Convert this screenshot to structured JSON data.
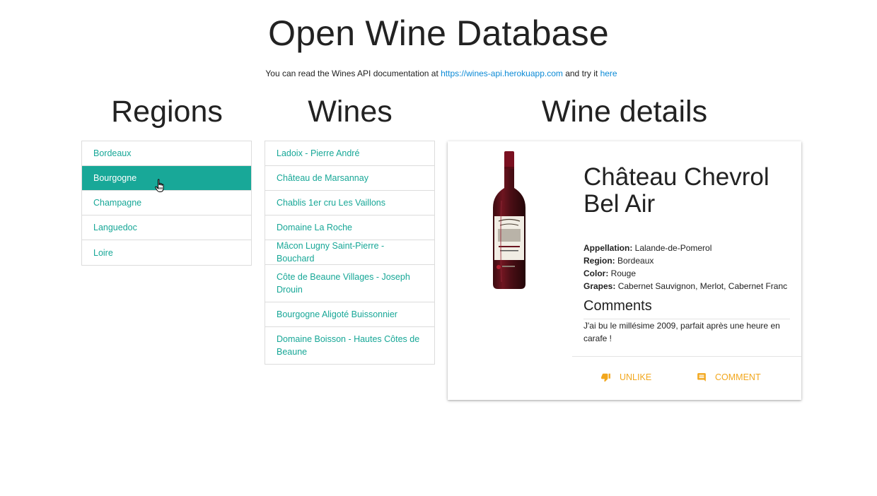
{
  "header": {
    "title": "Open Wine Database",
    "subtitle_prefix": "You can read the Wines API documentation at ",
    "api_link": "https://wines-api.herokuapp.com",
    "subtitle_middle": " and try it ",
    "try_link": "here"
  },
  "regions": {
    "heading": "Regions",
    "items": [
      "Bordeaux",
      "Bourgogne",
      "Champagne",
      "Languedoc",
      "Loire"
    ],
    "selected": "Bourgogne"
  },
  "wines": {
    "heading": "Wines",
    "items": [
      "Ladoix - Pierre André",
      "Château de Marsannay",
      "Chablis 1er cru Les Vaillons",
      "Domaine La Roche",
      "Mâcon Lugny Saint-Pierre - Bouchard",
      "Côte de Beaune Villages - Joseph Drouin",
      "Bourgogne Aligoté Buissonnier",
      "Domaine Boisson - Hautes Côtes de Beaune"
    ]
  },
  "details": {
    "heading": "Wine details",
    "name": "Château Chevrol Bel Air",
    "appellation_label": "Appellation:",
    "appellation": " Lalande-de-Pomerol",
    "region_label": "Region:",
    "region": " Bordeaux",
    "color_label": "Color:",
    "color": " Rouge",
    "grapes_label": "Grapes:",
    "grapes": " Cabernet Sauvignon, Merlot, Cabernet Franc",
    "comments_title": "Comments",
    "comment": "J'ai bu le millésime 2009, parfait après une heure en carafe !",
    "bottle_label_text": "Château Chevrol Bel Air",
    "unlike_label": "Unlike",
    "comment_label": "Comment",
    "unlike_icon": "thumb-down-icon",
    "comment_icon": "comment-icon"
  },
  "colors": {
    "accent": "#18a898",
    "link": "#0b8ad6",
    "action": "#f2a71d"
  }
}
